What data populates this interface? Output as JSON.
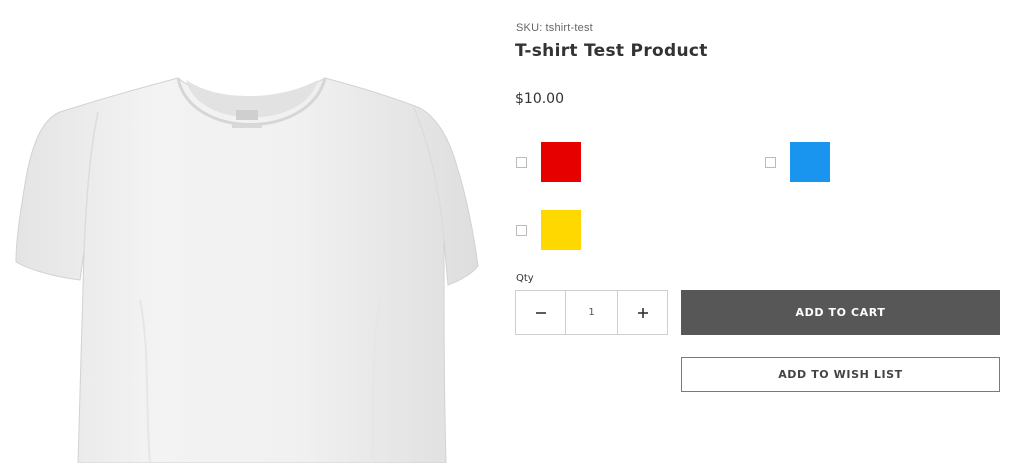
{
  "product": {
    "sku_label": "SKU:",
    "sku_value": "tshirt-test",
    "title": "T-shirt Test Product",
    "price": "$10.00",
    "image_alt": "white t-shirt"
  },
  "swatches": [
    {
      "name": "red",
      "color": "#e60000",
      "checked": false
    },
    {
      "name": "blue",
      "color": "#1a95ef",
      "checked": false
    },
    {
      "name": "yellow",
      "color": "#ffd800",
      "checked": false
    }
  ],
  "quantity": {
    "label": "Qty",
    "value": "1",
    "minus_icon": "minus-icon",
    "plus_icon": "plus-icon"
  },
  "actions": {
    "add_to_cart": "ADD TO CART",
    "add_to_wishlist": "ADD TO WISH LIST"
  },
  "colors": {
    "cart_button_bg": "#575757",
    "wish_button_border": "#7a7a7a"
  }
}
